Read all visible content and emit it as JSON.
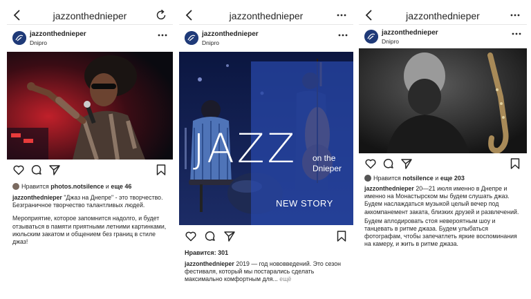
{
  "colors": {
    "text": "#262626",
    "muted": "#8e8e8e",
    "divider": "#e6e6e6",
    "brand_blue": "#1f3a78",
    "overlay_blue": "#2848aa"
  },
  "posts": [
    {
      "topbar": {
        "title": "jazzonthednieper",
        "back_icon": "chevron-left-icon",
        "right_icon": "refresh-icon"
      },
      "header": {
        "username": "jazzonthednieper",
        "location": "Dnipro",
        "more_icon": "more-dots-icon"
      },
      "photo_subject": "singer-on-stage",
      "likes": {
        "prefix": "Нравится",
        "user": "photos.notsilence",
        "joiner": "и",
        "others": "еще 46"
      },
      "caption": {
        "username": "jazzonthednieper",
        "text": "\"Джаз на Днепре\" - это творчество. Безграничное творчество талантливых людей.",
        "paragraph2": "Мероприятие, которое запомнится надолго, и будет отзываться в памяти приятными летними картинками, июльским закатом и общением без границ в стиле джаз!"
      }
    },
    {
      "topbar": {
        "title": "jazzonthednieper",
        "back_icon": "chevron-left-icon",
        "right_icon": "more-dots-icon"
      },
      "header": {
        "username": "jazzonthednieper",
        "location": "Dnipro",
        "more_icon": "more-dots-icon"
      },
      "photo_subject": "band-on-stage",
      "overlay": {
        "title": "JAZZ",
        "line1": "on the",
        "line2": "Dnieper",
        "story": "NEW STORY"
      },
      "likes": {
        "text": "Нравится: 301"
      },
      "caption": {
        "username": "jazzonthednieper",
        "text": "2019 — год нововведений. Это сезон фестиваля, который мы постарались сделать максимально комфортным для...",
        "more": "ещё"
      }
    },
    {
      "topbar": {
        "title": "jazzonthednieper",
        "back_icon": "chevron-left-icon",
        "right_icon": "more-dots-icon"
      },
      "header": {
        "username": "jazzonthednieper",
        "location": "Dnipro",
        "more_icon": "more-dots-icon"
      },
      "photo_subject": "saxophonist-portrait",
      "likes": {
        "prefix": "Нравится",
        "user": "notsilence",
        "joiner": "и",
        "others": "еще 203"
      },
      "caption": {
        "username": "jazzonthednieper",
        "text": "20—21 июля именно в Днепре и именно на Монастырском мы будем слушать джаз. Будем наслаждаться музыкой целый вечер под аккомпанемент заката, близких друзей и развлечений.",
        "paragraph2": "Будем аплодировать стоя невероятным шоу и танцевать в ритме джаза. Будем улыбаться фотографам, чтобы запечатлеть яркие воспоминания на камеру, и жить в ритме джаза."
      }
    }
  ]
}
